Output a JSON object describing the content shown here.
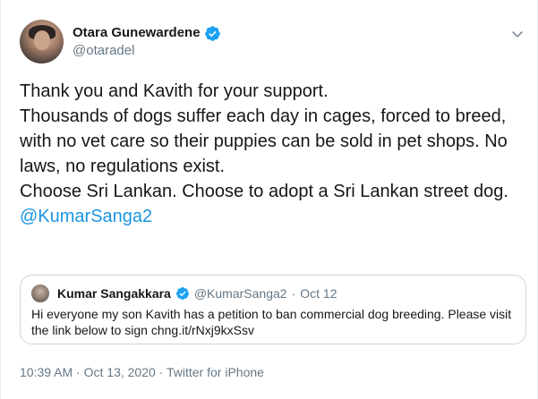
{
  "author": {
    "display_name": "Otara Gunewardene",
    "handle": "@otaradel"
  },
  "tweet": {
    "lines": [
      "Thank you and Kavith for your support.",
      "Thousands of dogs suffer each day in cages, forced to breed, with no vet care so their puppies can be sold in pet shops. No laws, no regulations exist.",
      "Choose Sri Lankan. Choose to adopt a Sri Lankan street dog."
    ],
    "mention": "@KumarSanga2"
  },
  "quote": {
    "display_name": "Kumar Sangakkara",
    "handle": "@KumarSanga2",
    "separator": "·",
    "date": "Oct 12",
    "text": "Hi everyone my son Kavith has a petition to ban commercial dog breeding. Please visit the link below to sign chng.it/rNxj9kxSsv"
  },
  "meta": {
    "time": "10:39 AM",
    "separator1": " · ",
    "date": "Oct 13, 2020",
    "separator2": " · ",
    "source": "Twitter for iPhone"
  },
  "colors": {
    "accent": "#1da1f2",
    "link": "#1b95e0",
    "muted": "#657786",
    "text": "#14171a",
    "border": "#ccd6dd"
  },
  "icons": {
    "verified": "verified-badge-icon",
    "more": "chevron-down-icon"
  }
}
